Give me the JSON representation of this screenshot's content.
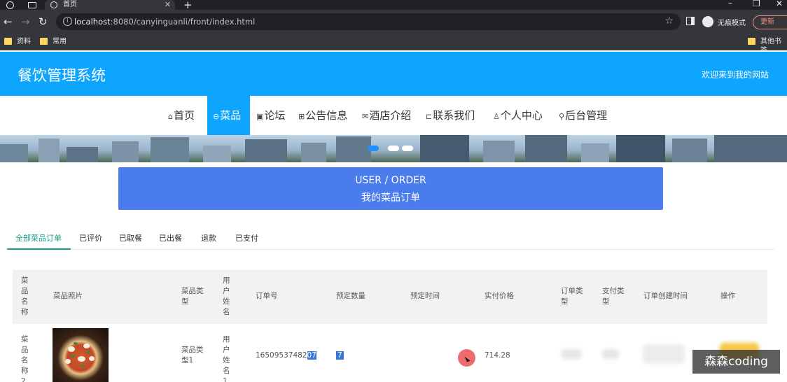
{
  "browser": {
    "tab_title": "首页",
    "url_host": "localhost",
    "url_rest": ":8080/canyinguanli/front/index.html",
    "profile_label": "无痕模式",
    "update_label": "更新",
    "bookmarks": [
      "资料",
      "常用"
    ],
    "other_bookmarks": "其他书签"
  },
  "site": {
    "title": "餐饮管理系统",
    "welcome": "欢迎来到我的网站"
  },
  "nav": [
    {
      "icon": "home-icon",
      "glyph": "⌂",
      "label": "首页"
    },
    {
      "icon": "dish-icon",
      "glyph": "⊖",
      "label": "菜品"
    },
    {
      "icon": "forum-icon",
      "glyph": "▣",
      "label": "论坛"
    },
    {
      "icon": "notice-icon",
      "glyph": "⊞",
      "label": "公告信息"
    },
    {
      "icon": "hotel-icon",
      "glyph": "✉",
      "label": "酒店介绍"
    },
    {
      "icon": "contact-icon",
      "glyph": "⊏",
      "label": "联系我们"
    },
    {
      "icon": "user-icon",
      "glyph": "♙",
      "label": "个人中心"
    },
    {
      "icon": "link-icon",
      "glyph": "⚲",
      "label": "后台管理"
    }
  ],
  "order_header": {
    "title_en": "USER / ORDER",
    "title_cn": "我的菜品订单"
  },
  "subtabs": [
    "全部菜品订单",
    "已评价",
    "已取餐",
    "已出餐",
    "退款",
    "已支付"
  ],
  "table": {
    "headers": [
      "菜品名称",
      "菜品照片",
      "菜品类型",
      "用户姓名",
      "订单号",
      "预定数量",
      "预定时间",
      "实付价格",
      "订单类型",
      "支付类型",
      "订单创建时间",
      "操作"
    ],
    "row": {
      "dish_name": "菜品名称2",
      "dish_type": "菜品类型1",
      "user_name": "用户姓名1",
      "order_no_main": "16509537482",
      "order_no_sel": "07",
      "quantity": "7",
      "price": "714.28"
    }
  },
  "watermark": "森森coding",
  "colors": {
    "header_bg": "#0ea5ff",
    "order_box": "#4a7cee",
    "tab_active": "#16a085"
  }
}
